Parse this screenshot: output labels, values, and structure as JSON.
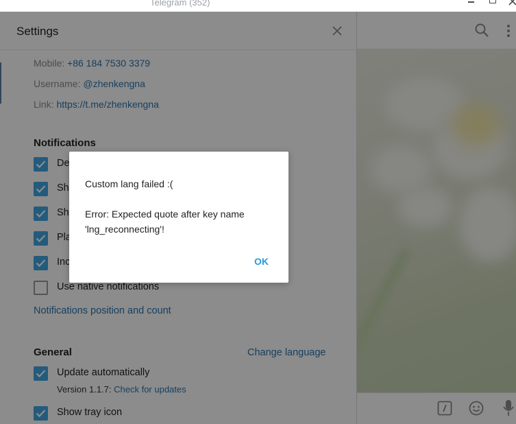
{
  "window": {
    "title": "Telegram (352)"
  },
  "settings": {
    "title": "Settings",
    "info": {
      "mobile_label": "Mobile:",
      "mobile_value": "+86 184 7530 3379",
      "username_label": "Username:",
      "username_value": "@zhenkengna",
      "link_label": "Link:",
      "link_value": "https://t.me/zhenkengna"
    },
    "notifications": {
      "title": "Notifications",
      "items": [
        {
          "label": "De",
          "checked": true
        },
        {
          "label": "Sho",
          "checked": true
        },
        {
          "label": "Sho",
          "checked": true
        },
        {
          "label": "Pla",
          "checked": true
        },
        {
          "label": "Inc",
          "checked": true
        },
        {
          "label": "Use native notifications",
          "checked": false
        }
      ],
      "position_link": "Notifications position and count"
    },
    "general": {
      "title": "General",
      "change_language": "Change language",
      "update_auto": "Update automatically",
      "version_prefix": "Version 1.1.7:",
      "check_updates": "Check for updates",
      "show_tray": "Show tray icon"
    }
  },
  "dialog": {
    "line1": "Custom lang failed :(",
    "line2": "Error: Expected quote after key name",
    "line3": "'lng_reconnecting'!",
    "ok": "OK"
  },
  "icons": {
    "search": "search-icon",
    "menu": "more-vertical-icon",
    "close": "close-icon",
    "commands": "commands-icon",
    "emoji": "emoji-icon",
    "mic": "microphone-icon"
  },
  "colors": {
    "accent": "#40a7e3",
    "link": "#2a74ad",
    "ok_button": "#2a9ad6"
  }
}
